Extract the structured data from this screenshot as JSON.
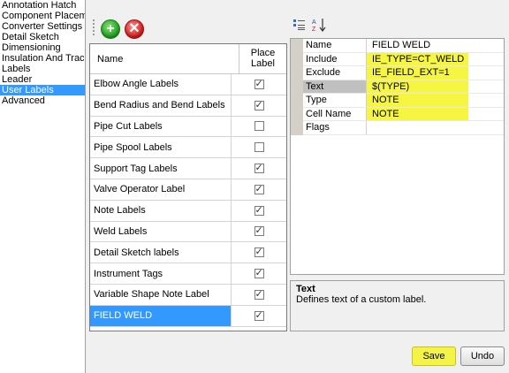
{
  "nav": {
    "items": [
      {
        "label": "Annotation Hatch",
        "selected": false
      },
      {
        "label": "Component Placeme",
        "selected": false
      },
      {
        "label": "Converter Settings",
        "selected": false
      },
      {
        "label": "Detail Sketch",
        "selected": false
      },
      {
        "label": "Dimensioning",
        "selected": false
      },
      {
        "label": "Insulation And Tracin",
        "selected": false
      },
      {
        "label": "Labels",
        "selected": false
      },
      {
        "label": "Leader",
        "selected": false
      },
      {
        "label": "User Labels",
        "selected": true
      },
      {
        "label": "Advanced",
        "selected": false
      }
    ]
  },
  "toolbar": {
    "add_icon": "add-icon",
    "delete_icon": "delete-icon"
  },
  "grid": {
    "col_name": "Name",
    "col_place": "Place Label",
    "rows": [
      {
        "name": "Elbow Angle Labels",
        "checked": true,
        "selected": false
      },
      {
        "name": "Bend Radius and Bend Labels",
        "checked": true,
        "selected": false
      },
      {
        "name": "Pipe Cut Labels",
        "checked": false,
        "selected": false
      },
      {
        "name": "Pipe Spool Labels",
        "checked": false,
        "selected": false
      },
      {
        "name": "Support Tag Labels",
        "checked": true,
        "selected": false
      },
      {
        "name": "Valve Operator Label",
        "checked": true,
        "selected": false
      },
      {
        "name": "Note Labels",
        "checked": true,
        "selected": false
      },
      {
        "name": "Weld Labels",
        "checked": true,
        "selected": false
      },
      {
        "name": "Detail Sketch labels",
        "checked": true,
        "selected": false
      },
      {
        "name": "Instrument Tags",
        "checked": true,
        "selected": false
      },
      {
        "name": "Variable Shape Note Label",
        "checked": true,
        "selected": false
      },
      {
        "name": "FIELD WELD",
        "checked": true,
        "selected": true
      }
    ]
  },
  "properties": {
    "rows": [
      {
        "name": "Name",
        "value": "FIELD WELD",
        "highlight": false,
        "active": false
      },
      {
        "name": "Include",
        "value": "IE_TYPE=CT_WELD",
        "highlight": true,
        "active": false
      },
      {
        "name": "Exclude",
        "value": "IE_FIELD_EXT=1",
        "highlight": true,
        "active": false
      },
      {
        "name": "Text",
        "value": "$(TYPE)",
        "highlight": true,
        "active": true
      },
      {
        "name": "Type",
        "value": "NOTE",
        "highlight": true,
        "active": false
      },
      {
        "name": "Cell Name",
        "value": "NOTE",
        "highlight": true,
        "active": false
      },
      {
        "name": "Flags",
        "value": "",
        "highlight": false,
        "active": false
      }
    ]
  },
  "description": {
    "title": "Text",
    "body": "Defines text of a custom label."
  },
  "buttons": {
    "save": "Save",
    "undo": "Undo"
  },
  "colors": {
    "selection": "#3399ff",
    "highlight": "#f5f542"
  }
}
